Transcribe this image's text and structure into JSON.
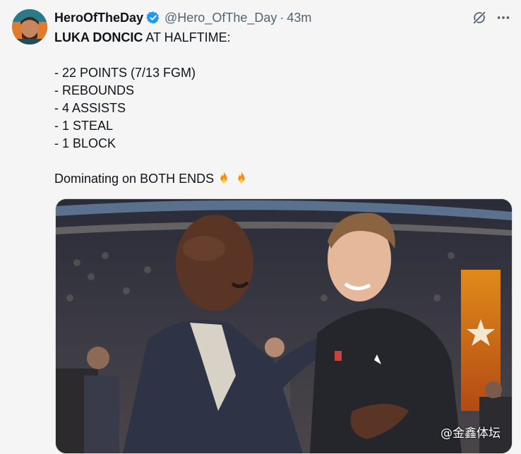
{
  "author": {
    "display_name": "HeroOfTheDay",
    "handle": "@Hero_OfThe_Day",
    "separator": "·",
    "time": "43m",
    "verified_icon": "verified-badge-icon",
    "verified_color": "#1d9bf0"
  },
  "actions": {
    "grok_icon": "grok-icon",
    "more_icon": "more-options-icon"
  },
  "tweet": {
    "headline_bold": "LUKA DONCIC",
    "headline_rest": " AT HALFTIME:",
    "lines": [
      "- 22 POINTS (7/13 FGM)",
      "- REBOUNDS",
      "- 4 ASSISTS",
      "- 1 STEAL",
      "- 1 BLOCK"
    ],
    "closing": "Dominating on BOTH ENDS",
    "emoji": "fire-emoji"
  },
  "media": {
    "watermark": "@金鑫体坛"
  }
}
